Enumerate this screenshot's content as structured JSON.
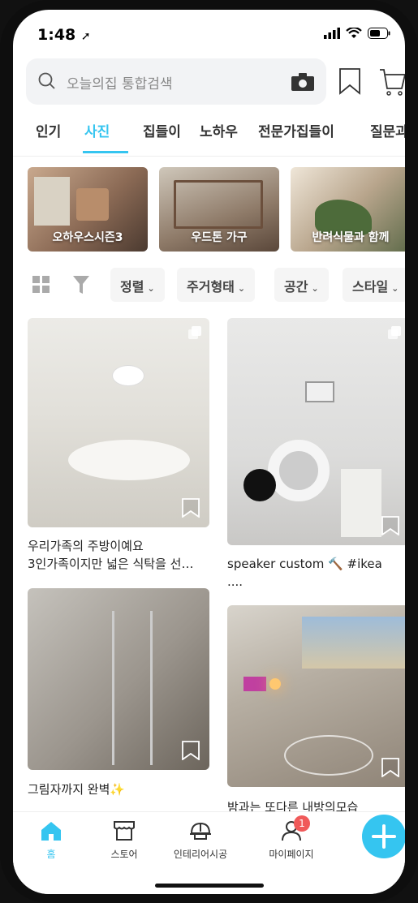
{
  "status": {
    "time": "1:48"
  },
  "search": {
    "placeholder": "오늘의집 통합검색"
  },
  "tabs": [
    {
      "label": "인기"
    },
    {
      "label": "사진"
    },
    {
      "label": "집들이"
    },
    {
      "label": "노하우"
    },
    {
      "label": "전문가집들이"
    },
    {
      "label": "질문과답"
    }
  ],
  "collections": [
    {
      "label": "오하우스시즌3"
    },
    {
      "label": "우드톤 가구"
    },
    {
      "label": "반려식물과 함께"
    }
  ],
  "filters": [
    {
      "label": "정렬"
    },
    {
      "label": "주거형태"
    },
    {
      "label": "공간"
    },
    {
      "label": "스타일"
    }
  ],
  "posts": [
    {
      "caption": "우리가족의 주방이예요\n3인가족이지만 넓은 식탁을 선…"
    },
    {
      "caption": "speaker custom 🔨 #ikea\n...."
    },
    {
      "caption": "그림자까지 완벽✨"
    },
    {
      "caption": "밤과는 또다른 내방의모습"
    }
  ],
  "bottom_nav": [
    {
      "label": "홈"
    },
    {
      "label": "스토어"
    },
    {
      "label": "인테리어시공"
    },
    {
      "label": "마이페이지",
      "badge": "1"
    }
  ],
  "colors": {
    "accent": "#35c5f0",
    "badge": "#f05a5a"
  }
}
